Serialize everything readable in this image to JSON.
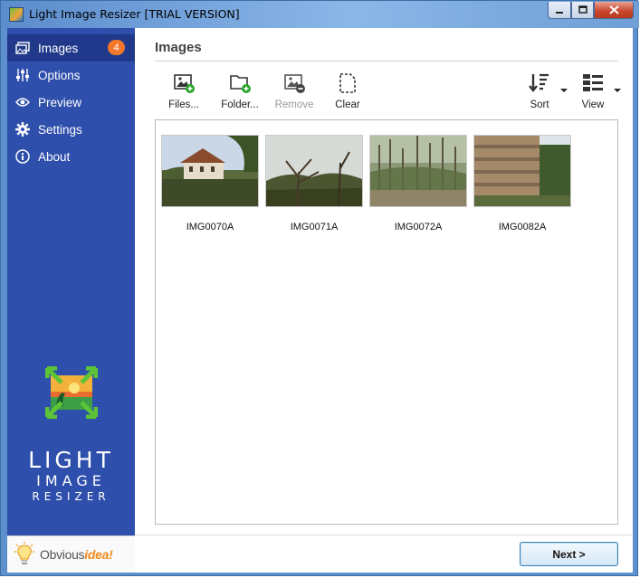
{
  "window": {
    "title": "Light Image Resizer  [TRIAL VERSION]",
    "minimize_symbol": "▁",
    "maximize_symbol": "□",
    "close_symbol": "✕"
  },
  "sidebar": {
    "items": [
      {
        "label": "Images",
        "icon": "images-icon",
        "badge": "4",
        "active": true
      },
      {
        "label": "Options",
        "icon": "sliders-icon"
      },
      {
        "label": "Preview",
        "icon": "eye-icon"
      },
      {
        "label": "Settings",
        "icon": "gear-icon"
      },
      {
        "label": "About",
        "icon": "info-icon"
      }
    ],
    "brand_line1": "LIGHT",
    "brand_line2": "IMAGE",
    "brand_line3": "RESIZER",
    "vendor_prefix": "Obvious",
    "vendor_suffix": "idea!"
  },
  "main": {
    "page_title": "Images",
    "toolbar": {
      "files_label": "Files...",
      "folder_label": "Folder...",
      "remove_label": "Remove",
      "clear_label": "Clear",
      "sort_label": "Sort",
      "view_label": "View"
    },
    "images": [
      {
        "name": "IMG0070A"
      },
      {
        "name": "IMG0071A"
      },
      {
        "name": "IMG0072A"
      },
      {
        "name": "IMG0082A"
      }
    ],
    "next_label": "Next >"
  },
  "colors": {
    "sidebar_bg": "#2f4fac",
    "sidebar_active": "#20398a",
    "badge": "#f3782a",
    "accent_green": "#2aa52a"
  }
}
